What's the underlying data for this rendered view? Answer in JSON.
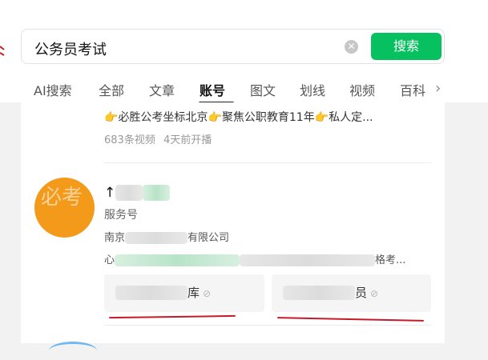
{
  "search": {
    "query": "公务员考试",
    "button_label": "搜索"
  },
  "tabs": [
    {
      "label": "AI搜索"
    },
    {
      "label": "全部"
    },
    {
      "label": "文章"
    },
    {
      "label": "账号",
      "active": true
    },
    {
      "label": "图文"
    },
    {
      "label": "划线"
    },
    {
      "label": "视频"
    },
    {
      "label": "百科"
    }
  ],
  "previous_result": {
    "promo_hand_1": "👉",
    "promo_1": "必胜公考坐标北京",
    "promo_hand_2": "👉",
    "promo_2": "聚焦公职教育11年",
    "promo_hand_3": "👉",
    "promo_3": "私人定...",
    "video_count": "683条视频",
    "live_time": "4天前开播"
  },
  "account": {
    "avatar_text": "必考",
    "name_prefix": "↑",
    "type": "服务号",
    "company_prefix": "南京",
    "company_suffix": "有限公司",
    "desc_prefix": "心",
    "desc_suffix": "格考...",
    "chip_1_suffix": "库",
    "chip_2_suffix": "员"
  },
  "colors": {
    "accent": "#07c160",
    "avatar_bg": "#f39a1a",
    "annotation_red": "#c61a2a"
  }
}
